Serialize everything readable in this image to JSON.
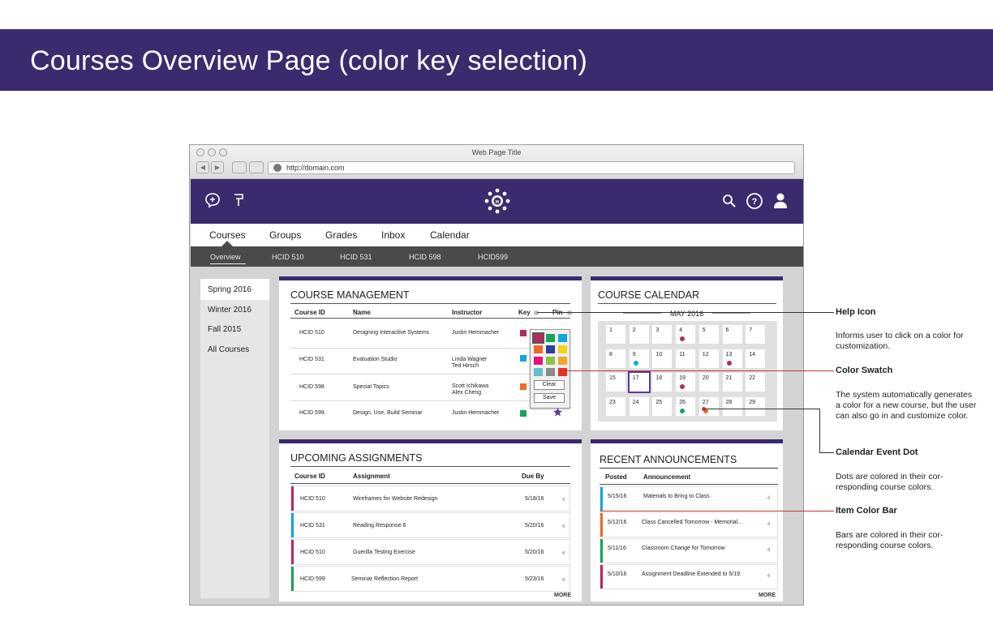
{
  "page_title": "Courses Overview Page (color key selection)",
  "window": {
    "title": "Web Page Title",
    "url": "http://domain.com"
  },
  "nav": {
    "tabs": [
      "Courses",
      "Groups",
      "Grades",
      "Inbox",
      "Calendar"
    ]
  },
  "subnav": {
    "tabs": [
      "Overview",
      "HCID 510",
      "HCID 531",
      "HCID 598",
      "HCID599"
    ]
  },
  "sidebar": {
    "items": [
      "Spring 2016",
      "Winter 2016",
      "Fall 2015",
      "All Courses"
    ]
  },
  "course_management": {
    "title": "COURSE MANAGEMENT",
    "headers": {
      "id": "Course ID",
      "name": "Name",
      "instructor": "Instructor",
      "key": "Key",
      "pin": "Pin"
    },
    "rows": [
      {
        "id": "HCID 510",
        "name": "Designing Interactive Systems",
        "instructor": "Justin Hemmacher",
        "color": "#b5295f"
      },
      {
        "id": "HCID 531",
        "name": "Evaluation Studio",
        "instructor": "Linda Wagner\nTed Hirsch",
        "color": "#12a6d8"
      },
      {
        "id": "HCID 598",
        "name": "Special Topics",
        "instructor": "Scott Ichikawa\nAlex Cheng",
        "color": "#ee6a23"
      },
      {
        "id": "HCID 599",
        "name": "Design, Use, Build Seminar",
        "instructor": "Justin Hemmacher",
        "color": "#16a35a"
      }
    ]
  },
  "color_popup": {
    "clear_label": "Clear",
    "save_label": "Save",
    "swatches": [
      "#b5295f",
      "#16a35a",
      "#12a6d8",
      "#ee6a23",
      "#2a3f9c",
      "#f2d21b",
      "#e5127e",
      "#8bc34a",
      "#f5a623",
      "#5fc0c8",
      "#8a8a8a",
      "#e53223"
    ]
  },
  "calendar": {
    "title": "COURSE CALENDAR",
    "month": "MAY 2016",
    "today": "17",
    "days": [
      {
        "n": "1"
      },
      {
        "n": "2"
      },
      {
        "n": "3"
      },
      {
        "n": "4",
        "dot": "#b5295f"
      },
      {
        "n": "5"
      },
      {
        "n": "6"
      },
      {
        "n": "7"
      },
      {
        "n": "8"
      },
      {
        "n": "9",
        "dot": "#12a6d8"
      },
      {
        "n": "10"
      },
      {
        "n": "11"
      },
      {
        "n": "12"
      },
      {
        "n": "13",
        "dot": "#b5295f"
      },
      {
        "n": "14"
      },
      {
        "n": "15"
      },
      {
        "n": "17"
      },
      {
        "n": "18"
      },
      {
        "n": "19",
        "dot": "#b5295f"
      },
      {
        "n": "20"
      },
      {
        "n": "21"
      },
      {
        "n": "22"
      },
      {
        "n": "23"
      },
      {
        "n": "24"
      },
      {
        "n": "25"
      },
      {
        "n": "26",
        "dot": "#16a35a"
      },
      {
        "n": "27",
        "dot": "#ee6a23"
      },
      {
        "n": "28"
      },
      {
        "n": "29"
      }
    ]
  },
  "assignments": {
    "title": "UPCOMING ASSIGNMENTS",
    "headers": {
      "id": "Course ID",
      "assignment": "Assignment",
      "due": "Due By"
    },
    "rows": [
      {
        "id": "HCID 510",
        "assignment": "Wireframes for Website Redesign",
        "due": "5/18/16",
        "color": "#b5295f"
      },
      {
        "id": "HCID 531",
        "assignment": "Reading Response 6",
        "due": "5/20/16",
        "color": "#12a6d8"
      },
      {
        "id": "HCID 510",
        "assignment": "Guerilla Testing Exercise",
        "due": "5/20/16",
        "color": "#b5295f"
      },
      {
        "id": "HCID 599",
        "assignment": "Seminar Reflection Report",
        "due": "5/23/16",
        "color": "#16a35a"
      }
    ],
    "more": "MORE"
  },
  "announcements": {
    "title": "RECENT ANNOUNCEMENTS",
    "headers": {
      "posted": "Posted",
      "announcement": "Announcement"
    },
    "rows": [
      {
        "posted": "5/15/16",
        "text": "Materials to Bring to Class",
        "color": "#12a6d8"
      },
      {
        "posted": "5/12/16",
        "text": "Class Cancelled Tomorrow - Memorial...",
        "color": "#ee6a23"
      },
      {
        "posted": "5/11/16",
        "text": "Classroom Change for Tomorrow",
        "color": "#16a35a"
      },
      {
        "posted": "5/10/16",
        "text": "Assignment Deadline Extended to 5/19",
        "color": "#b5295f"
      }
    ],
    "more": "MORE"
  },
  "annotations": [
    {
      "title": "Help Icon",
      "desc": "Informs user to click on a color for customization."
    },
    {
      "title": "Color Swatch",
      "desc": "The system automatically generates a color for a new course, but the user can also go in and customize color."
    },
    {
      "title": "Calendar Event Dot",
      "desc": "Dots are colored in their cor-responding course colors."
    },
    {
      "title": "Item Color Bar",
      "desc": "Bars are colored in their cor-responding course colors."
    }
  ],
  "icons": [
    "chat-icon",
    "flag-icon",
    "logo-icon",
    "search-icon",
    "help-icon",
    "user-icon",
    "star-icon"
  ],
  "colors": {
    "brand": "#3b2a6e",
    "subnav": "#4a4a4a"
  }
}
